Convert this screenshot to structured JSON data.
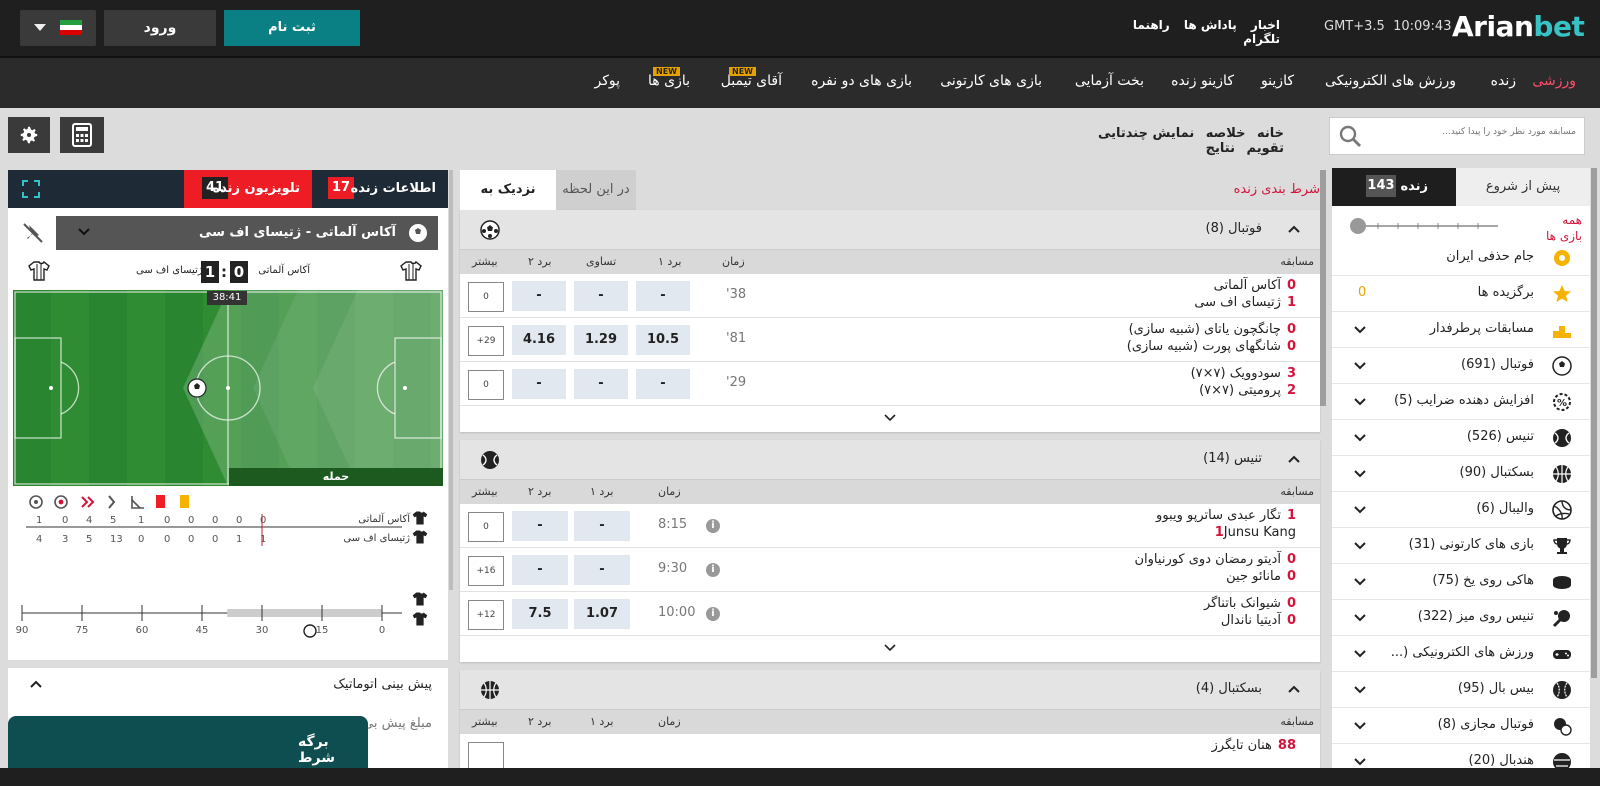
{
  "header": {
    "logo": "Arianbet",
    "logo_a": "Arian",
    "logo_b": "bet",
    "clock": "10:09:43",
    "timezone": "GMT+3.5",
    "links": [
      "تلگرام",
      "راهنما",
      "پاداش ها",
      "اخبار"
    ],
    "register_label": "ثبت نام",
    "login_label": "ورود",
    "language_flag": "iran-flag"
  },
  "nav": {
    "items": [
      {
        "label": "ورزشی",
        "active": true
      },
      {
        "label": "زنده"
      },
      {
        "label": "ورزش های الکترونیکی"
      },
      {
        "label": "کازینو"
      },
      {
        "label": "کازینو زنده"
      },
      {
        "label": "بخت آزمایی"
      },
      {
        "label": "بازی های کارتونی"
      },
      {
        "label": "بازی های دو نفره"
      },
      {
        "label": "آقای تیمبل",
        "badge": "NEW"
      },
      {
        "label": "بازی ها",
        "badge": "NEW"
      },
      {
        "label": "پوکر"
      }
    ]
  },
  "subnav": {
    "items": [
      "خانه",
      "خلاصه",
      "نمایش چندتایی",
      "تقویم",
      "نتایج"
    ]
  },
  "search": {
    "placeholder": "مسابقه مورد نظر خود را پیدا کنید..."
  },
  "live_panel": {
    "tab_tv": "تلویزیون زنده",
    "tab_tv_count": "41",
    "tab_info": "اطلاعات زنده",
    "tab_info_count": "17",
    "match_select": "آکاس آلماتی - ژتیسای اف سی",
    "home_team": "آکاس آلماتی",
    "away_team": "ژتیسای اف سی",
    "home_score": "0",
    "away_score": "1",
    "score_sep": ":",
    "match_clock": "38:41",
    "attack_label": "حمله",
    "stats_home_team": "آکاس آلماتی",
    "stats_away_team": "ژتیسای اف سی",
    "stats_home": [
      "1",
      "0",
      "4",
      "5",
      "1",
      "0",
      "0",
      "0",
      "0",
      "0"
    ],
    "stats_away": [
      "4",
      "3",
      "5",
      "13",
      "0",
      "0",
      "0",
      "0",
      "1",
      "1"
    ],
    "timeline_ticks": [
      "90",
      "75",
      "60",
      "45",
      "30",
      "15",
      "0"
    ],
    "timeline_progress": 0.43
  },
  "auto_prediction": {
    "title": "پیش بینی اتوماتیک",
    "amount_label": "مبلغ پیش بی"
  },
  "betslip": {
    "label": "برگه شرط"
  },
  "center": {
    "tab_upcoming": "نزدیک به شروع",
    "tab_now": "در این لحظه",
    "live_bet_label": "شرط بندی زنده",
    "col_labels": {
      "match": "مسابقه",
      "time": "زمان",
      "win1": "برد ۱",
      "draw": "تساوی",
      "win2": "برد ۲",
      "more": "بیشتر"
    },
    "football": {
      "title": "فوتبال",
      "count": "(8)",
      "rows": [
        {
          "t1": "آکاس آلماتی",
          "s1": "0",
          "t2": "ژتیسای اف سی",
          "s2": "1",
          "time": "'38",
          "o1": "-",
          "ox": "-",
          "o2": "-",
          "more": "0"
        },
        {
          "t1": "چانگچون یاتای (شبیه سازی)",
          "s1": "0",
          "t2": "شانگهای پورت (شبیه سازی)",
          "s2": "0",
          "time": "'81",
          "o1": "10.5",
          "ox": "1.29",
          "o2": "4.16",
          "more": "+29"
        },
        {
          "t1": "سودوویک (۷×۷)",
          "s1": "3",
          "t2": "پرومیتی (۷×۷)",
          "s2": "2",
          "time": "'29",
          "o1": "-",
          "ox": "-",
          "o2": "-",
          "more": "0"
        }
      ]
    },
    "tennis": {
      "title": "تنیس",
      "count": "(14)",
      "rows": [
        {
          "t1": "تگار عبدی ساترپو ویبوو",
          "s1": "1",
          "t2": "Junsu Kang",
          "s2": "1",
          "time": "8:15",
          "o1": "-",
          "o2": "-",
          "more": "0"
        },
        {
          "t1": "آدیتو رمضان دوی کورنیاوان",
          "s1": "0",
          "t2": "مانائو جین",
          "s2": "0",
          "time": "9:30",
          "o1": "-",
          "o2": "-",
          "more": "+16"
        },
        {
          "t1": "شیوانک باتناگر",
          "s1": "0",
          "t2": "آدیتیا ناندال",
          "s2": "0",
          "time": "10:00",
          "o1": "1.07",
          "o2": "7.5",
          "more": "+12"
        }
      ]
    },
    "basketball": {
      "title": "بسکتبال",
      "count": "(4)",
      "row_partial": {
        "t1": "هنان تایگرز",
        "s1": "88"
      }
    }
  },
  "sidebar": {
    "tab_pre": "پیش از شروع",
    "tab_live": "زنده",
    "tab_live_count": "143",
    "all_games": "همه بازی ها",
    "items": [
      {
        "label": "جام حذفی ایران",
        "icon": "football-cup-icon"
      },
      {
        "label": "برگزیده ها",
        "icon": "star-icon",
        "count": "0"
      },
      {
        "label": "مسابقات پرطرفدار",
        "icon": "podium-icon"
      },
      {
        "label": "فوتبال (691)",
        "icon": "football-icon"
      },
      {
        "label": "افزایش دهنده ضرایب (5)",
        "icon": "odds-boost-icon"
      },
      {
        "label": "تنیس (526)",
        "icon": "tennis-icon"
      },
      {
        "label": "بسکتبال (90)",
        "icon": "basketball-icon"
      },
      {
        "label": "والیبال (6)",
        "icon": "volleyball-icon"
      },
      {
        "label": "بازی های کارتونی (31)",
        "icon": "trophy-icon"
      },
      {
        "label": "هاکی روی یخ (75)",
        "icon": "hockey-puck-icon"
      },
      {
        "label": "تنیس روی میز (322)",
        "icon": "table-tennis-icon"
      },
      {
        "label": "ورزش های الکترونیکی (...",
        "icon": "gamepad-icon"
      },
      {
        "label": "بیس بال (95)",
        "icon": "baseball-icon"
      },
      {
        "label": "فوتبال مجازی (8)",
        "icon": "virtual-football-icon"
      },
      {
        "label": "هندبال (20)",
        "icon": "handball-icon"
      }
    ]
  },
  "colors": {
    "accent": "#0a7f84",
    "live_red": "#ee1c25",
    "active_nav": "#ff4d6a",
    "pitch": "#2f8c33"
  }
}
